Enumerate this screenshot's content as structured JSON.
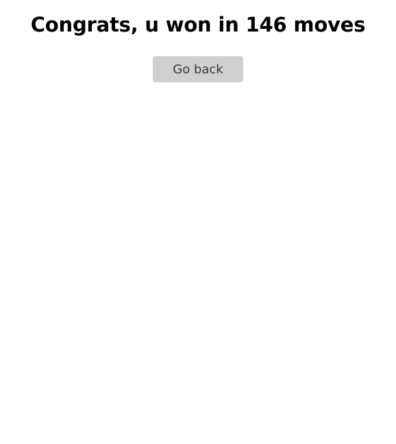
{
  "result": {
    "title": "Congrats, u won in 146 moves",
    "moves": 146
  },
  "actions": {
    "back_label": "Go back"
  }
}
